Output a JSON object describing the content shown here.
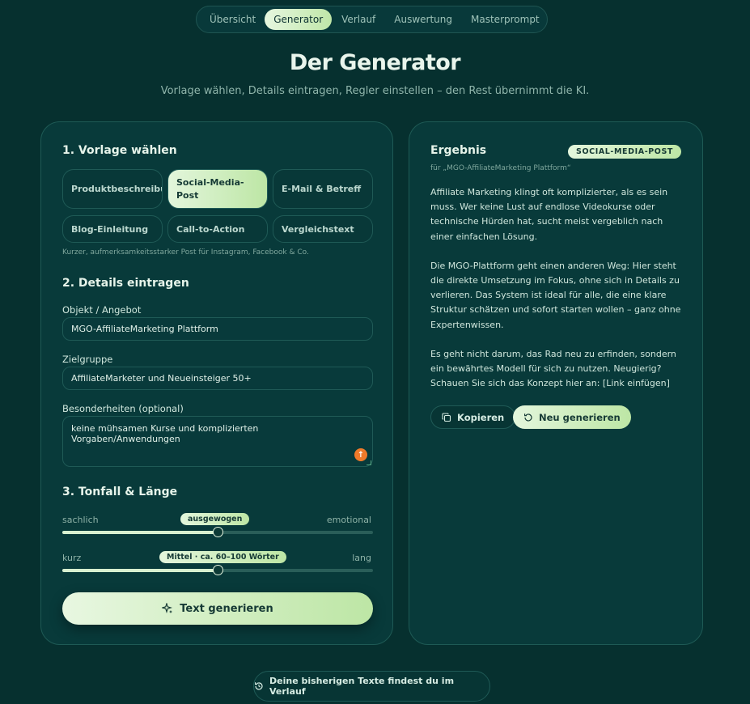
{
  "nav": {
    "tabs": [
      {
        "label": "Übersicht"
      },
      {
        "label": "Generator"
      },
      {
        "label": "Verlauf"
      },
      {
        "label": "Auswertung"
      },
      {
        "label": "Masterprompt"
      }
    ],
    "active": "Generator"
  },
  "hero": {
    "title": "Der Generator",
    "subtitle": "Vorlage wählen, Details eintragen, Regler einstellen – den Rest übernimmt die KI."
  },
  "left": {
    "section1_title": "1. Vorlage wählen",
    "templates": [
      {
        "label": "Produktbeschreibung"
      },
      {
        "label": "Social-Media-Post"
      },
      {
        "label": "E-Mail & Betreff"
      },
      {
        "label": "Blog-Einleitung"
      },
      {
        "label": "Call-to-Action"
      },
      {
        "label": "Vergleichstext"
      }
    ],
    "selected_template": "Social-Media-Post",
    "template_hint": "Kurzer, aufmerksamkeitsstarker Post für Instagram, Facebook & Co.",
    "section2_title": "2. Details eintragen",
    "object_label": "Objekt / Angebot",
    "object_value": "MGO-AffiliateMarketing Plattform",
    "target_label": "Zielgruppe",
    "target_value": "AffiliateMarketer und Neueinsteiger 50+",
    "special_label": "Besonderheiten (optional)",
    "special_value": "keine mühsamen Kurse und komplizierten Vorgaben/Anwendungen",
    "section3_title": "3. Tonfall & Länge",
    "tone": {
      "min_label": "sachlich",
      "max_label": "emotional",
      "value_label": "ausgewogen",
      "value": 0.5
    },
    "length": {
      "min_label": "kurz",
      "max_label": "lang",
      "value_label": "Mittel · ca. 60–100 Wörter",
      "value": 0.5
    },
    "generate_label": "Text generieren"
  },
  "right": {
    "title": "Ergebnis",
    "type_badge": "SOCIAL-MEDIA-POST",
    "for_line": "für „MGO-AffiliateMarketing Plattform“",
    "paragraphs": [
      "Affiliate Marketing klingt oft komplizierter, als es sein muss. Wer keine Lust auf endlose Videokurse oder technische Hürden hat, sucht meist vergeblich nach einer einfachen Lösung.",
      "Die MGO-Plattform geht einen anderen Weg: Hier steht die direkte Umsetzung im Fokus, ohne sich in Details zu verlieren. Das System ist ideal für alle, die eine klare Struktur schätzen und sofort starten wollen – ganz ohne Expertenwissen.",
      "Es geht nicht darum, das Rad neu zu erfinden, sondern ein bewährtes Modell für sich zu nutzen. Neugierig? Schauen Sie sich das Konzept hier an: [Link einfügen]"
    ],
    "copy_label": "Kopieren",
    "regenerate_label": "Neu generieren"
  },
  "footer": {
    "history_label": "Deine bisherigen Texte findest du im Verlauf"
  },
  "colors": {
    "accent": "#bde6a5",
    "background": "#06302f",
    "card": "#083a3a",
    "warning": "#f07a2a"
  }
}
